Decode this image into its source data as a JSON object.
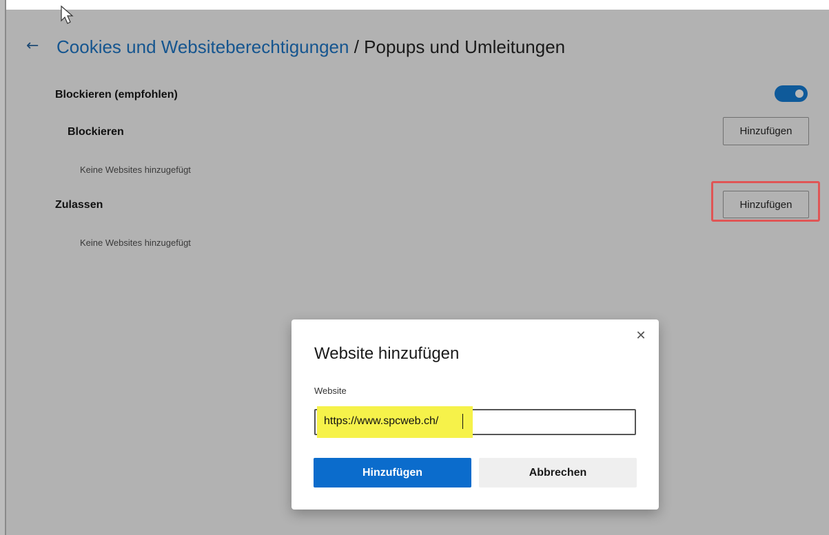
{
  "header": {
    "back_icon": "arrow-left-icon",
    "breadcrumb_parent": "Cookies und Websiteberechtigungen",
    "breadcrumb_separator": " / ",
    "breadcrumb_current": "Popups und Umleitungen"
  },
  "settings": {
    "block_recommended_label": "Blockieren (empfohlen)",
    "block_recommended_enabled": true,
    "block_section_label": "Blockieren",
    "block_add_button": "Hinzufügen",
    "block_empty_text": "Keine Websites hinzugefügt",
    "allow_section_label": "Zulassen",
    "allow_add_button": "Hinzufügen",
    "allow_empty_text": "Keine Websites hinzugefügt"
  },
  "dialog": {
    "title": "Website hinzufügen",
    "close_icon": "close-icon",
    "field_label": "Website",
    "field_value": "https://www.spcweb.ch/",
    "confirm_button": "Hinzufügen",
    "cancel_button": "Abbrechen"
  },
  "colors": {
    "accent": "#0b6ccc",
    "link": "#15558f",
    "toggle_on": "#0f5a9a",
    "annotation_box": "#e05555",
    "text_highlight": "#f6f24a"
  }
}
